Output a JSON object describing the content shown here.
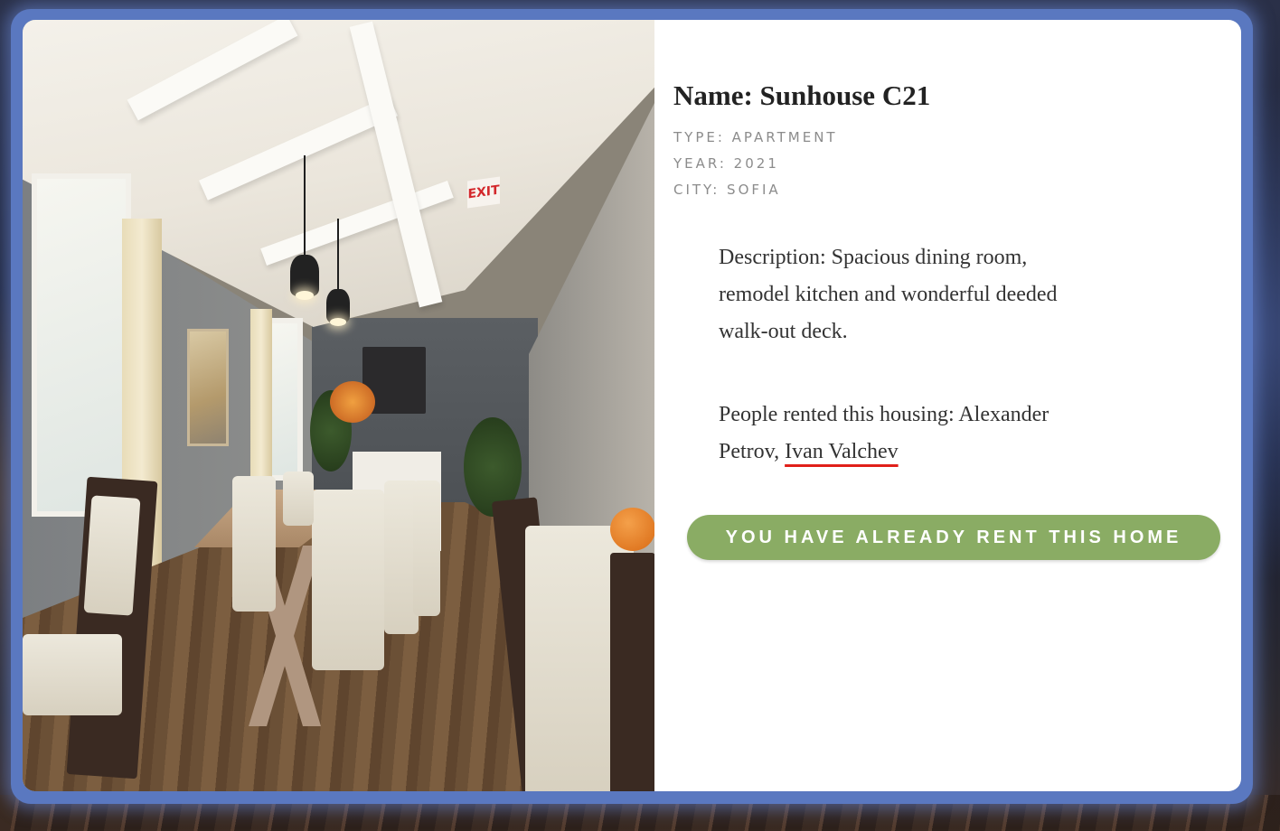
{
  "listing": {
    "name_label": "Name: Sunhouse C21",
    "type_label": "TYPE: APARTMENT",
    "year_label": "YEAR: 2021",
    "city_label": "CITY: SOFIA",
    "description": "Description: Spacious dining room, remodel kitchen and wonderful deeded walk-out deck.",
    "renters_prefix": "People rented this housing: Alexander Petrov, ",
    "renters_highlighted": "Ivan Valchev",
    "rent_button_label": "YOU HAVE ALREADY RENT THIS HOME",
    "photo_sign_text": "EXIT"
  },
  "colors": {
    "frame": "#5a78c0",
    "button": "#8aac64",
    "highlight_underline": "#e0201a",
    "meta_text": "#8c8c8c"
  }
}
